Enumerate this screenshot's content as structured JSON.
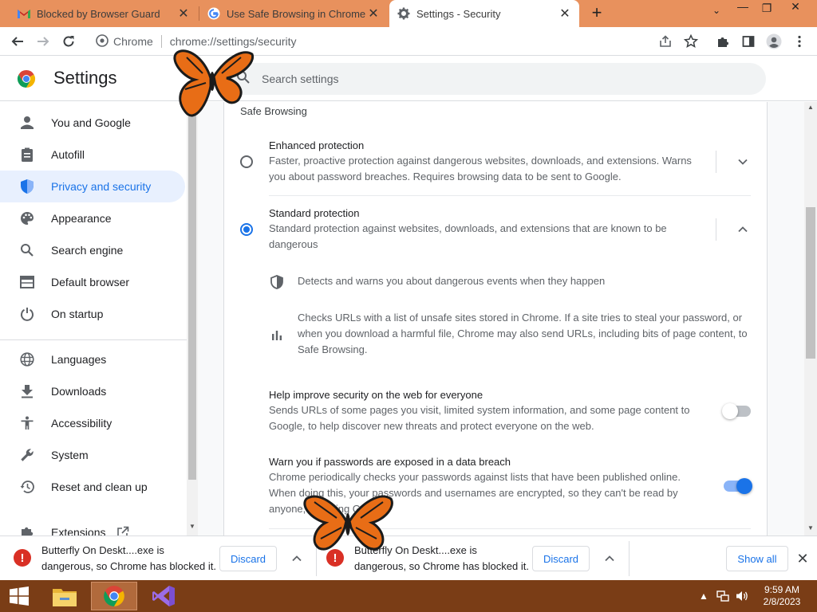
{
  "browser": {
    "tabs": [
      {
        "title": "Blocked by Browser Guard",
        "favicon": "gmail-icon",
        "active": false
      },
      {
        "title": "Use Safe Browsing in Chrome - C",
        "favicon": "google-icon",
        "active": false
      },
      {
        "title": "Settings - Security",
        "favicon": "gear-icon",
        "active": true
      }
    ],
    "new_tab_label": "+",
    "omnibox": {
      "chip": "Chrome",
      "url": "chrome://settings/security"
    }
  },
  "settings": {
    "title": "Settings",
    "search_placeholder": "Search settings",
    "nav": [
      {
        "label": "You and Google",
        "icon": "person-icon"
      },
      {
        "label": "Autofill",
        "icon": "clipboard-icon"
      },
      {
        "label": "Privacy and security",
        "icon": "shield-icon",
        "active": true
      },
      {
        "label": "Appearance",
        "icon": "palette-icon"
      },
      {
        "label": "Search engine",
        "icon": "search-icon"
      },
      {
        "label": "Default browser",
        "icon": "browser-window-icon"
      },
      {
        "label": "On startup",
        "icon": "power-icon"
      },
      {
        "label": "Languages",
        "icon": "globe-icon"
      },
      {
        "label": "Downloads",
        "icon": "download-icon"
      },
      {
        "label": "Accessibility",
        "icon": "accessibility-icon"
      },
      {
        "label": "System",
        "icon": "wrench-icon"
      },
      {
        "label": "Reset and clean up",
        "icon": "history-icon"
      },
      {
        "label": "Extensions",
        "icon": "puzzle-icon"
      }
    ],
    "safe_browsing": {
      "section_title": "Safe Browsing",
      "enhanced": {
        "title": "Enhanced protection",
        "description": "Faster, proactive protection against dangerous websites, downloads, and extensions. Warns you about password breaches. Requires browsing data to be sent to Google.",
        "selected": false
      },
      "standard": {
        "title": "Standard protection",
        "description": "Standard protection against websites, downloads, and extensions that are known to be dangerous",
        "selected": true,
        "details": [
          {
            "icon": "shield-icon",
            "text": "Detects and warns you about dangerous events when they happen"
          },
          {
            "icon": "bar-chart-icon",
            "text": "Checks URLs with a list of unsafe sites stored in Chrome. If a site tries to steal your password, or when you download a harmful file, Chrome may also send URLs, including bits of page content, to Safe Browsing."
          }
        ]
      },
      "help_improve": {
        "title": "Help improve security on the web for everyone",
        "description": "Sends URLs of some pages you visit, limited system information, and some page content to Google, to help discover new threats and protect everyone on the web.",
        "enabled": false
      },
      "password_warn": {
        "title": "Warn you if passwords are exposed in a data breach",
        "description": "Chrome periodically checks your passwords against lists that have been published online. When doing this, your passwords and usernames are encrypted, so they can't be read by anyone, including Google.",
        "enabled": true
      }
    }
  },
  "downloads": {
    "items": [
      {
        "text_line1": "Butterfly On Deskt....exe is",
        "text_line2": "dangerous, so Chrome has blocked it.",
        "discard_label": "Discard"
      },
      {
        "text_line1": "Butterfly On Deskt....exe is",
        "text_line2": "dangerous, so Chrome has blocked it.",
        "discard_label": "Discard"
      }
    ],
    "show_all_label": "Show all"
  },
  "taskbar": {
    "apps": [
      "file-explorer-icon",
      "chrome-icon",
      "visual-studio-icon"
    ],
    "time": "9:59 AM",
    "date": "2/8/2023"
  },
  "colors": {
    "tabstrip": "#e8915d",
    "accent": "#1a73e8",
    "taskbar": "#7a3d16",
    "danger": "#d93025"
  }
}
